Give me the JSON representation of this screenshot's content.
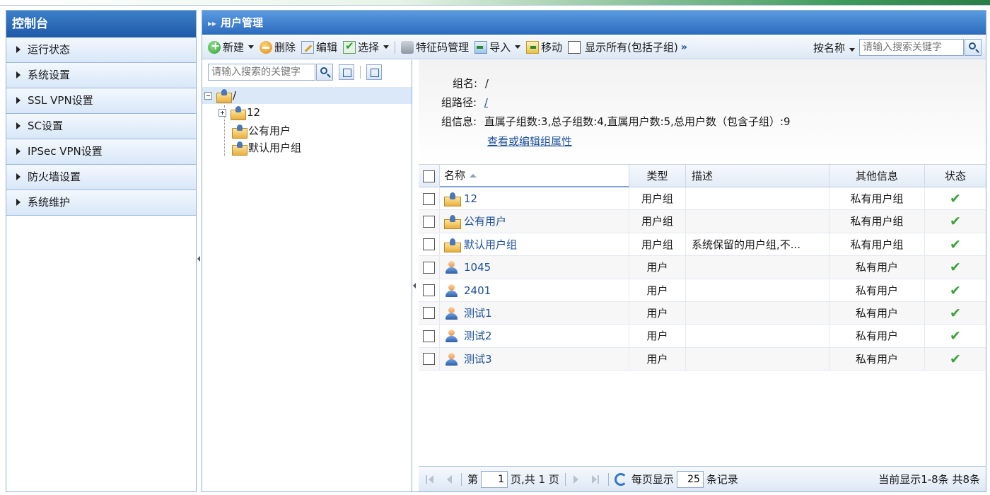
{
  "sidebar": {
    "title": "控制台",
    "items": [
      {
        "label": "运行状态"
      },
      {
        "label": "系统设置"
      },
      {
        "label": "SSL VPN设置"
      },
      {
        "label": "SC设置"
      },
      {
        "label": "IPSec VPN设置"
      },
      {
        "label": "防火墙设置"
      },
      {
        "label": "系统维护"
      }
    ]
  },
  "main": {
    "title": "用户管理",
    "toolbar": {
      "new_label": "新建",
      "delete_label": "删除",
      "edit_label": "编辑",
      "select_label": "选择",
      "feature_label": "特征码管理",
      "import_label": "导入",
      "move_label": "移动",
      "show_all_label": "显示所有(包括子组)",
      "more_label": "»",
      "search_by_label": "按名称",
      "search_placeholder": "请输入搜索关键字"
    },
    "tree": {
      "search_placeholder": "请输入搜索的关键字",
      "root": "/",
      "nodes": [
        {
          "label": "12"
        },
        {
          "label": "公有用户"
        },
        {
          "label": "默认用户组"
        }
      ]
    },
    "info": {
      "group_name_label": "组名:",
      "group_name_value": "/",
      "group_path_label": "组路径:",
      "group_path_value": "/",
      "group_info_label": "组信息:",
      "group_info_value": "直属子组数:3,总子组数:4,直属用户数:5,总用户数（包含子组）:9",
      "edit_link": "查看或编辑组属性"
    },
    "grid": {
      "headers": {
        "name": "名称",
        "type": "类型",
        "desc": "描述",
        "other": "其他信息",
        "status": "状态"
      },
      "rows": [
        {
          "name": "12",
          "kind": "group",
          "type": "用户组",
          "desc": "",
          "other": "私有用户组"
        },
        {
          "name": "公有用户",
          "kind": "group",
          "type": "用户组",
          "desc": "",
          "other": "私有用户组"
        },
        {
          "name": "默认用户组",
          "kind": "group",
          "type": "用户组",
          "desc": "系统保留的用户组,不...",
          "other": "私有用户组"
        },
        {
          "name": "1045",
          "kind": "user",
          "type": "用户",
          "desc": "",
          "other": "私有用户"
        },
        {
          "name": "2401",
          "kind": "user",
          "type": "用户",
          "desc": "",
          "other": "私有用户"
        },
        {
          "name": "测试1",
          "kind": "user",
          "type": "用户",
          "desc": "",
          "other": "私有用户"
        },
        {
          "name": "测试2",
          "kind": "user",
          "type": "用户",
          "desc": "",
          "other": "私有用户"
        },
        {
          "name": "测试3",
          "kind": "user",
          "type": "用户",
          "desc": "",
          "other": "私有用户"
        }
      ]
    },
    "pager": {
      "page_prefix": "第",
      "page_value": "1",
      "page_suffix": "页,共 1 页",
      "per_page_label": "每页显示",
      "per_page_value": "25",
      "per_page_suffix": "条记录",
      "summary": "当前显示1-8条 共8条"
    }
  },
  "colors": {
    "accent": "#2b6bbd",
    "link": "#1a4f9a",
    "status_ok": "#3aa33a"
  },
  "icons": {
    "status_ok": "check-icon",
    "group": "folder-user-icon",
    "user": "user-icon"
  }
}
